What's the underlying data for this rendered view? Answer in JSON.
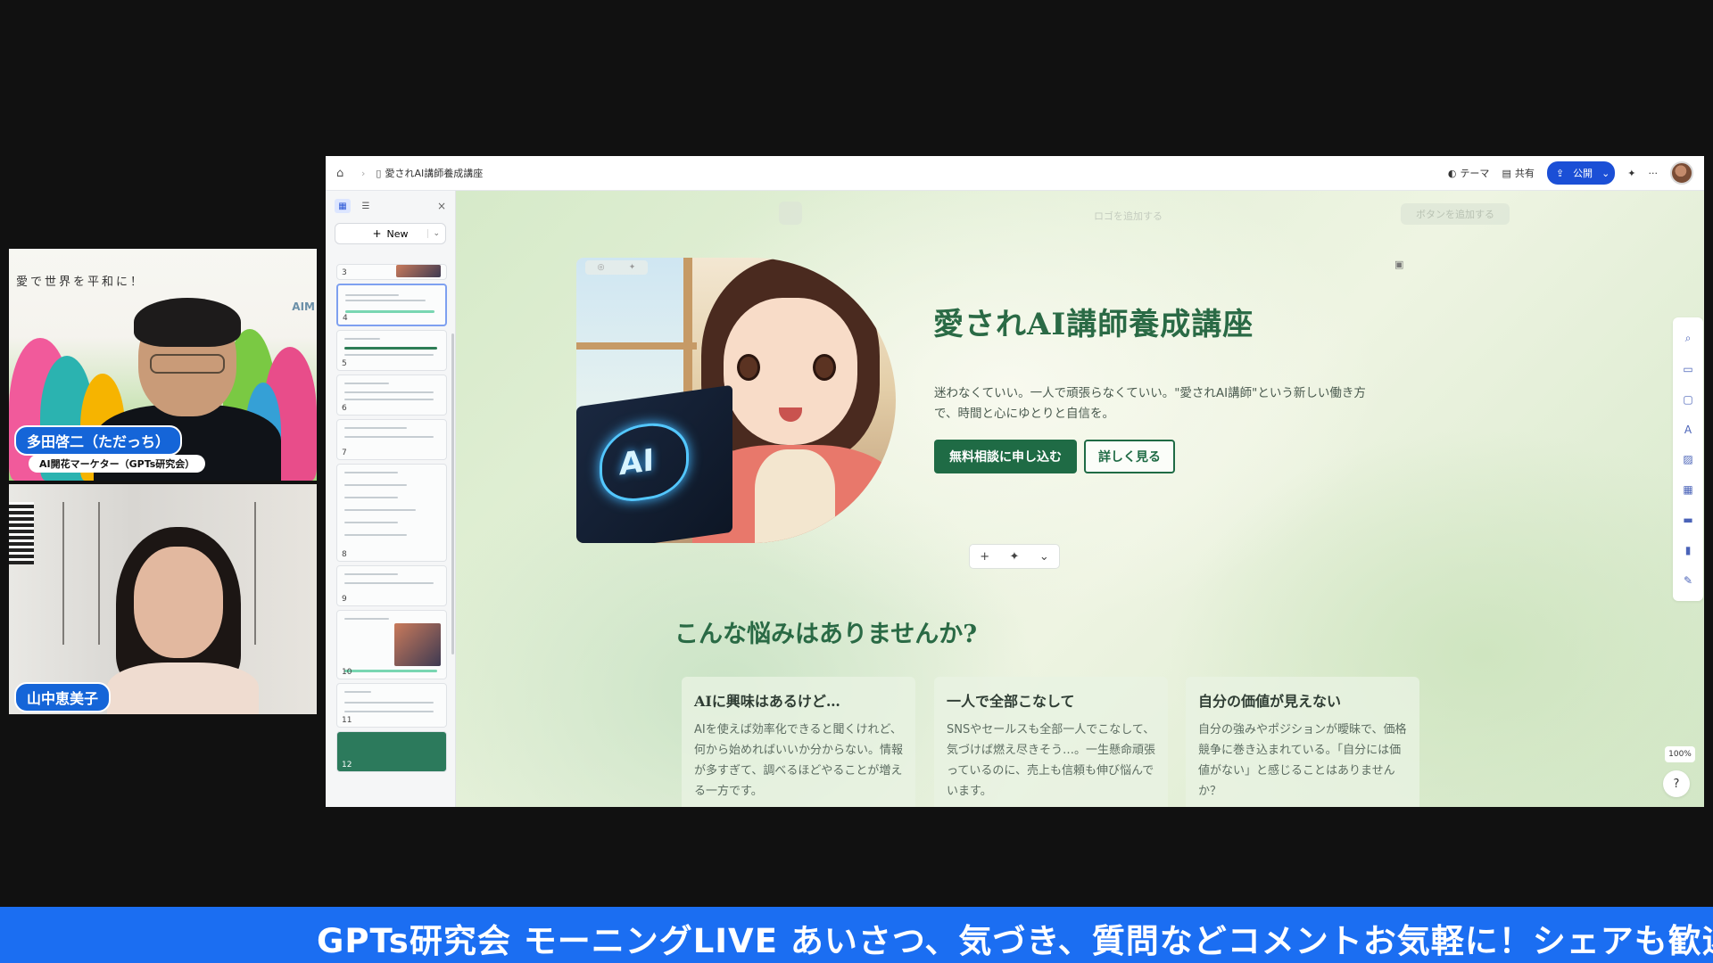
{
  "webcams": {
    "top": {
      "motto": "愛で世界を平和に！",
      "logo": "AIM",
      "name": "多田啓二（ただっち）",
      "title": "AI開花マーケター（GPTs研究会）"
    },
    "bottom": {
      "name": "山中恵美子"
    }
  },
  "topbar": {
    "doc_title": "愛されAI講師養成講座",
    "theme_label": "テーマ",
    "share_label": "共有",
    "publish_label": "公開"
  },
  "sidebar": {
    "new_label": "New",
    "pages": [
      "3",
      "4",
      "5",
      "6",
      "7",
      "8",
      "9",
      "10",
      "11",
      "12"
    ]
  },
  "canvas": {
    "ghost_add_logo": "ロゴを追加する",
    "ghost_add_button": "ボタンを追加する",
    "hero": {
      "image_text": "AI",
      "title": "愛されAI講師養成講座",
      "description": "迷わなくていい。一人で頑張らなくていい。\"愛されAI講師\"という新しい働き方で、時間と心にゆとりと自信を。",
      "primary_button": "無料相談に申し込む",
      "secondary_button": "詳しく見る"
    },
    "section_title": "こんな悩みはありませんか?",
    "cards": [
      {
        "title": "AIに興味はあるけど…",
        "body": "AIを使えば効率化できると聞くけれど、何から始めればいいか分からない。情報が多すぎて、調べるほどやることが増える一方です。"
      },
      {
        "title": "一人で全部こなして",
        "body": "SNSやセールスも全部一人でこなして、気づけば燃え尽きそう…。一生懸命頑張っているのに、売上も信頼も伸び悩んでいます。"
      },
      {
        "title": "自分の価値が見えない",
        "body": "自分の強みやポジションが曖昧で、価格競争に巻き込まれている。「自分には価値がない」と感じることはありませんか？"
      }
    ],
    "zoom": "100%",
    "help": "?"
  },
  "ticker": {
    "text": "GPTs研究会 モーニングLIVE あいさつ、気づき、質問などコメントお気軽に！シェアも歓迎"
  }
}
